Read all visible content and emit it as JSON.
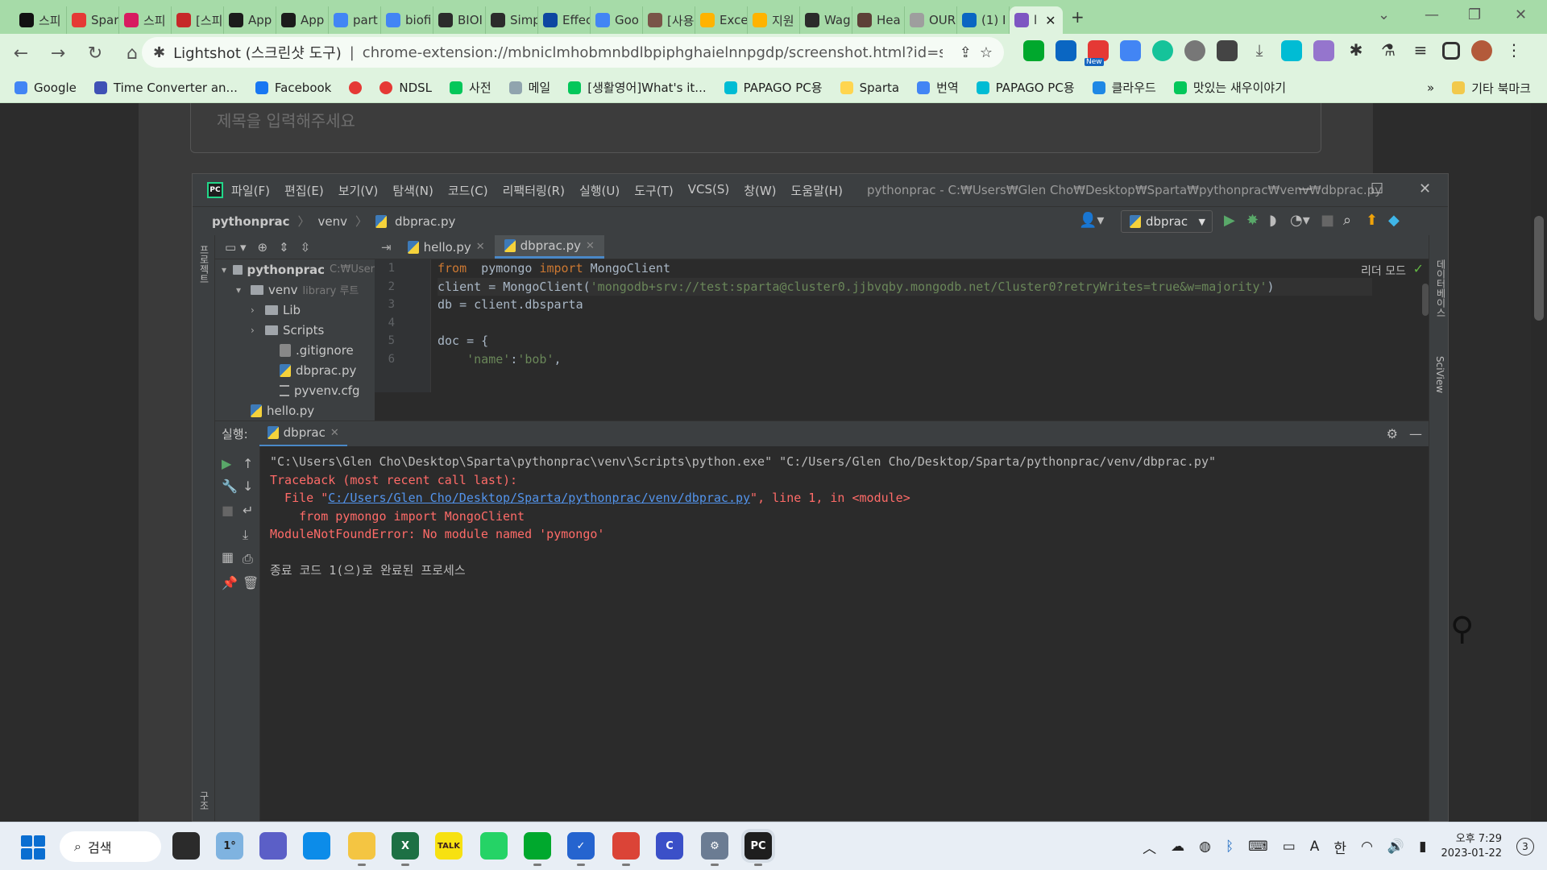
{
  "browser": {
    "tabs": [
      {
        "label": "스피",
        "color": "#111111"
      },
      {
        "label": "Spar",
        "color": "#e53935"
      },
      {
        "label": "스피",
        "color": "#d81b60"
      },
      {
        "label": "[스피",
        "color": "#c62828"
      },
      {
        "label": "App",
        "color": "#1b1b1b"
      },
      {
        "label": "App",
        "color": "#1b1b1b"
      },
      {
        "label": "part",
        "color": "#4285f4"
      },
      {
        "label": "biofi",
        "color": "#4285f4"
      },
      {
        "label": "BIOI",
        "color": "#2b2b2b"
      },
      {
        "label": "Simp",
        "color": "#2b2b2b"
      },
      {
        "label": "Effec",
        "color": "#0d47a1"
      },
      {
        "label": "Goo",
        "color": "#4285f4"
      },
      {
        "label": "[사용",
        "color": "#795548"
      },
      {
        "label": "Exce",
        "color": "#ffb300"
      },
      {
        "label": "지원",
        "color": "#ffb300"
      },
      {
        "label": "Wag",
        "color": "#2b2b2b"
      },
      {
        "label": "Hea",
        "color": "#5d4037"
      },
      {
        "label": "OUR",
        "color": "#9e9e9e"
      },
      {
        "label": "(1) I",
        "color": "#0a66c2"
      },
      {
        "label": "l",
        "color": "#7e57c2"
      }
    ],
    "new_tab_symbol": "+",
    "address": {
      "site_name": "Lightshot (스크린샷 도구)",
      "separator": "|",
      "url": "chrome-extension://mbniclmhobmnbdlbpiphghaielnnpgdp/screenshot.html?id=screenshot..."
    },
    "extension_badge_new": "New",
    "bookmarks": [
      {
        "label": "Google",
        "color": "#4285f4"
      },
      {
        "label": "Time Converter an...",
        "color": "#3f51b5"
      },
      {
        "label": "Facebook",
        "color": "#1877f2"
      },
      {
        "label": "",
        "color": "#e53935"
      },
      {
        "label": "NDSL",
        "color": "#e53935"
      },
      {
        "label": "사전",
        "color": "#03c75a"
      },
      {
        "label": "메일",
        "color": "#90a4ae"
      },
      {
        "label": "[생활영어]What's it...",
        "color": "#03c75a"
      },
      {
        "label": "PAPAGO PC용",
        "color": "#00bcd4"
      },
      {
        "label": "Sparta",
        "color": "#ffd54f"
      },
      {
        "label": "번역",
        "color": "#4285f4"
      },
      {
        "label": "PAPAGO PC용",
        "color": "#00bcd4"
      },
      {
        "label": "클라우드",
        "color": "#1e88e5"
      },
      {
        "label": "맛있는 새우이야기",
        "color": "#03c75a"
      }
    ],
    "bookmarks_overflow": "»",
    "other_bookmarks": "기타 북마크"
  },
  "page": {
    "title_placeholder": "제목을 입력해주세요"
  },
  "ide": {
    "menu": [
      "파일(F)",
      "편집(E)",
      "보기(V)",
      "탐색(N)",
      "코드(C)",
      "리팩터링(R)",
      "실행(U)",
      "도구(T)",
      "VCS(S)",
      "창(W)",
      "도움말(H)"
    ],
    "window_title": "pythonprac - C:₩Users₩Glen Cho₩Desktop₩Sparta₩pythonprac₩venv₩dbprac.py",
    "breadcrumbs": [
      "pythonprac",
      "venv",
      "dbprac.py"
    ],
    "run_config": "dbprac",
    "left_strip_label": "프로젝트",
    "left_strip_label_bottom": "구조",
    "right_strip_label": "데이터베이스",
    "right_strip_label2": "SciView",
    "project_tree": [
      {
        "label": "pythonprac",
        "hint": "C:₩User",
        "depth": 0,
        "arrow": "▾",
        "type": "folder",
        "bold": true
      },
      {
        "label": "venv",
        "hint": "library 루트",
        "depth": 1,
        "arrow": "▾",
        "type": "folder"
      },
      {
        "label": "Lib",
        "hint": "",
        "depth": 2,
        "arrow": "›",
        "type": "folder"
      },
      {
        "label": "Scripts",
        "hint": "",
        "depth": 2,
        "arrow": "›",
        "type": "folder"
      },
      {
        "label": ".gitignore",
        "hint": "",
        "depth": 3,
        "arrow": "",
        "type": "file"
      },
      {
        "label": "dbprac.py",
        "hint": "",
        "depth": 3,
        "arrow": "",
        "type": "py"
      },
      {
        "label": "pyvenv.cfg",
        "hint": "",
        "depth": 3,
        "arrow": "",
        "type": "cfg"
      },
      {
        "label": "hello.py",
        "hint": "",
        "depth": 1,
        "arrow": "",
        "type": "py"
      }
    ],
    "editor_tabs": [
      {
        "label": "hello.py",
        "active": false
      },
      {
        "label": "dbprac.py",
        "active": true
      }
    ],
    "reader_mode": "리더 모드",
    "code_lines": [
      {
        "n": "1",
        "parts": [
          [
            "kw",
            "from"
          ],
          [
            "",
            "  pymongo "
          ],
          [
            "kw",
            "import"
          ],
          [
            "",
            " MongoClient"
          ]
        ]
      },
      {
        "n": "2",
        "parts": [
          [
            "",
            "client = MongoClient("
          ],
          [
            "str",
            "'mongodb+srv://test:sparta@cluster0.jjbvqby.mongodb.net/Cluster0?retryWrites=true&w=majority'"
          ],
          [
            "",
            ")"
          ]
        ]
      },
      {
        "n": "3",
        "parts": [
          [
            "",
            "db = client.dbsparta"
          ]
        ]
      },
      {
        "n": "4",
        "parts": [
          [
            "",
            ""
          ]
        ]
      },
      {
        "n": "5",
        "parts": [
          [
            "",
            "doc = {"
          ]
        ]
      },
      {
        "n": "6",
        "parts": [
          [
            "",
            "    "
          ],
          [
            "str",
            "'name'"
          ],
          [
            "",
            ":"
          ],
          [
            "str",
            "'bob'"
          ],
          [
            "",
            ","
          ]
        ]
      }
    ],
    "run_panel": {
      "label": "실행:",
      "tab": "dbprac",
      "console": [
        {
          "type": "normal",
          "text": "\"C:\\Users\\Glen Cho\\Desktop\\Sparta\\pythonprac\\venv\\Scripts\\python.exe\" \"C:/Users/Glen Cho/Desktop/Sparta/pythonprac/venv/dbprac.py\""
        },
        {
          "type": "err",
          "text": "Traceback (most recent call last):"
        },
        {
          "type": "file",
          "pre": "  File \"",
          "link": "C:/Users/Glen Cho/Desktop/Sparta/pythonprac/venv/dbprac.py",
          "post": "\", line 1, in <module>"
        },
        {
          "type": "err",
          "text": "    from pymongo import MongoClient"
        },
        {
          "type": "err",
          "text": "ModuleNotFoundError: No module named 'pymongo'"
        },
        {
          "type": "normal",
          "text": ""
        },
        {
          "type": "normal",
          "text": "종료 코드 1(으)로 완료된 프로세스"
        }
      ]
    }
  },
  "taskbar": {
    "search_label": "검색",
    "weather": "1°",
    "apps": [
      {
        "name": "task-view",
        "label": "",
        "color": "#2b2b2b"
      },
      {
        "name": "weather",
        "label": "1°",
        "color": "#7fb3e0"
      },
      {
        "name": "zoom",
        "label": "",
        "color": "#5b5fc7"
      },
      {
        "name": "edge",
        "label": "",
        "color": "#0c8ce9"
      },
      {
        "name": "explorer",
        "label": "",
        "color": "#f4c542"
      },
      {
        "name": "excel",
        "label": "X",
        "color": "#1d7044"
      },
      {
        "name": "kakaotalk",
        "label": "TALK",
        "color": "#f7e111"
      },
      {
        "name": "whatsapp",
        "label": "",
        "color": "#25d366"
      },
      {
        "name": "evernote",
        "label": "",
        "color": "#00a82d"
      },
      {
        "name": "todo",
        "label": "✓",
        "color": "#2564cf"
      },
      {
        "name": "chrome-beta",
        "label": "",
        "color": "#db4437"
      },
      {
        "name": "app-c",
        "label": "C",
        "color": "#3b50c8"
      },
      {
        "name": "settings",
        "label": "⚙",
        "color": "#6b7c93"
      },
      {
        "name": "pycharm",
        "label": "PC",
        "color": "#1e1e1e"
      }
    ],
    "tray_lang": "한",
    "clock_period_time": "오후 7:29",
    "clock_date": "2023-01-22",
    "notifications": "3"
  }
}
